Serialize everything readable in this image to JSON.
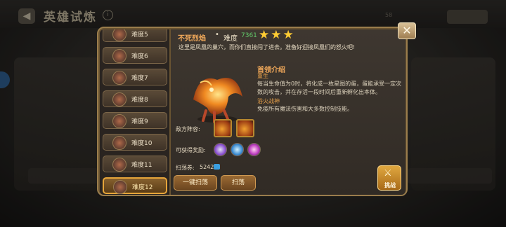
{
  "top": {
    "title": "英雄试炼",
    "info_icon": "info-icon",
    "back_icon": "back-arrow-icon",
    "note": "58",
    "button_label": ""
  },
  "level_list": {
    "selected_index": 7,
    "items": [
      {
        "label": "难度5"
      },
      {
        "label": "难度6"
      },
      {
        "label": "难度7"
      },
      {
        "label": "难度8"
      },
      {
        "label": "难度9"
      },
      {
        "label": "难度10"
      },
      {
        "label": "难度11"
      },
      {
        "label": "难度12"
      }
    ]
  },
  "detail": {
    "boss_name": "不死烈焰",
    "separator": "•",
    "difficulty_name": "难度",
    "power": "7361",
    "stars": "★★★",
    "star_count": 3,
    "description": "这里是凤凰的巢穴，而你们直接闯了进去。准备好迎接凤凰们的怒火吧!",
    "intro_title": "首领介绍",
    "skills": [
      {
        "name": "重生",
        "desc": "每当生命值为0时，将化成一枚星图的蛋，蛋能承受一定次数的攻击，并在存活一段时间后重新孵化出本体。"
      },
      {
        "name": "浴火战神",
        "desc": "免疫所有魔法伤害和大多数控制技能。"
      }
    ],
    "enemy_label": "敌方阵容:",
    "reward_label": "可获得奖励:",
    "sweep_label": "扫荡券:",
    "sweep_count": "5242"
  },
  "buttons": {
    "close": "✕",
    "sweep_all": "一键扫荡",
    "sweep": "扫荡",
    "challenge": "挑战",
    "challenge_icon": "crossed-swords-icon"
  },
  "colors": {
    "accent_orange": "#f0a85a",
    "power_green": "#62c86a",
    "star_gold": "#ffcc33",
    "panel_bg": "#312b25",
    "selected_border": "#e6a53a"
  }
}
